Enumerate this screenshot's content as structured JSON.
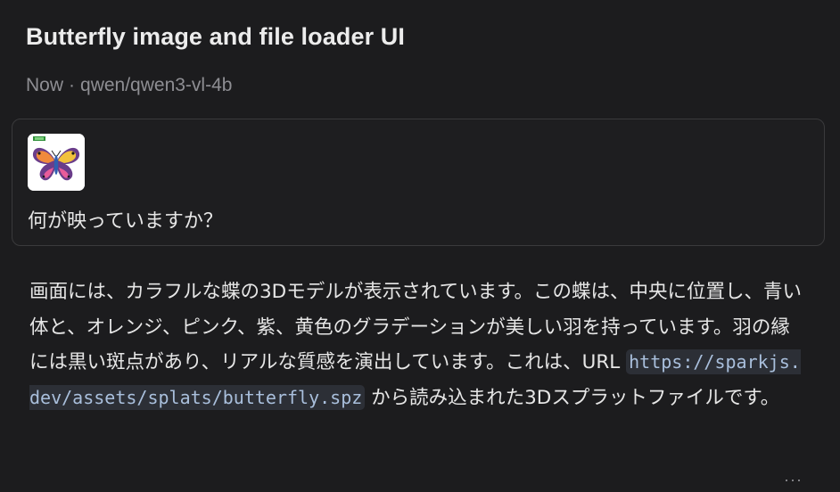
{
  "conversation": {
    "title": "Butterfly image and file loader UI",
    "timestamp": "Now",
    "separator": "·",
    "model": "qwen/qwen3-vl-4b"
  },
  "user_message": {
    "attachment_icon": "butterfly-image-thumbnail",
    "text": "何が映っていますか？"
  },
  "assistant_message": {
    "text_before": "画面には、カラフルな蝶の3Dモデルが表示されています。この蝶は、中央に位置し、青い体と、オレンジ、ピンク、紫、黄色のグラデーションが美しい羽を持っています。羽の縁には黒い斑点があり、リアルな質感を演出しています。これは、URL ",
    "url": "https://sparkjs.dev/assets/splats/butterfly.spz",
    "text_after": " から読み込まれた3Dスプラットファイルです。"
  },
  "actions": {
    "more_label": "···"
  }
}
